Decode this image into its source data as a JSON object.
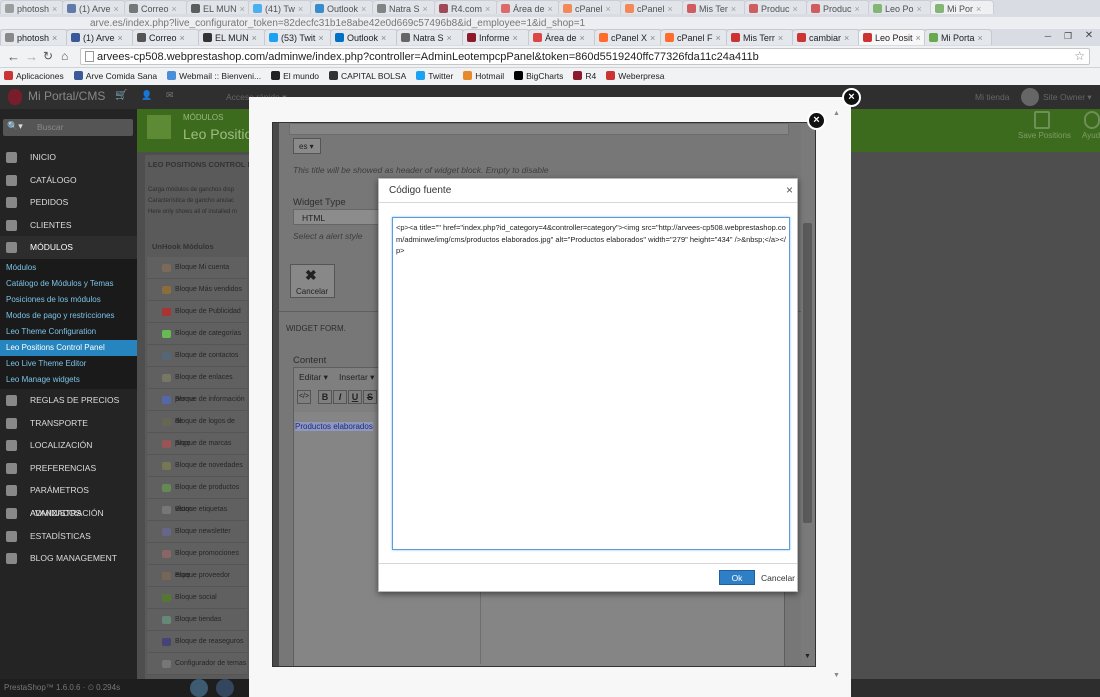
{
  "browser": {
    "tabs_row1": [
      "photosh",
      "(1) Arve",
      "Correo",
      "EL MUN",
      "(41) Tw",
      "Outlook",
      "Natra S",
      "R4.com",
      "Área de",
      "cPanel",
      "cPanel",
      "Mis Ter",
      "Produc",
      "Produc",
      "Leo Po",
      "Mi Por"
    ],
    "tabs_row2": [
      "photosh",
      "(1) Arve",
      "Correo",
      "EL MUN",
      "(53) Twit",
      "Outlook",
      "Natra S",
      "Informe",
      "Área de",
      "cPanel X",
      "cPanel F",
      "Mis Terr",
      "cambiar",
      "Leo Posit",
      "Mi Porta"
    ],
    "url_prev": "arve.es/index.php?live_configurator_token=82decfc31b1e8abe42e0d669c57496b8&id_employee=1&id_shop=1",
    "url": "arvees-cp508.webprestashop.com/adminwe/index.php?controller=AdminLeotempcpPanel&token=860d5519240ffc77326fda11c24a411b",
    "bookmarks": [
      "Aplicaciones",
      "Arve Comida Sana",
      "Webmail :: Bienveni...",
      "El mundo",
      "CAPITAL BOLSA",
      "Twitter",
      "Hotmail",
      "BigCharts",
      "R4",
      "Weberpresa"
    ]
  },
  "admin": {
    "brand": "Mi Portal/CMS",
    "quick_access": "Acceso rápido ▾",
    "my_shop": "Mi tienda",
    "user": "Site Owner ▾",
    "search_placeholder": "Buscar",
    "breadcrumb": "MÓDULOS",
    "page_title": "Leo Positions Control Panel",
    "toolbar_save": "Save Positions",
    "toolbar_help": "Ayuda",
    "footer": "PrestaShop™ 1.6.0.6 · ⏲ 0.294s",
    "menu": [
      "INICIO",
      "CATÁLOGO",
      "PEDIDOS",
      "CLIENTES",
      "MÓDULOS",
      "REGLAS DE PRECIOS",
      "TRANSPORTE",
      "LOCALIZACIÓN",
      "PREFERENCIAS",
      "PARÁMETROS AVANZADOS",
      "ADMINISTRACIÓN",
      "ESTADÍSTICAS",
      "BLOG MANAGEMENT"
    ],
    "submenu": [
      "Módulos",
      "Catálogo de Módulos y Temas",
      "Posiciones de los módulos",
      "Modos de pago y restricciones",
      "Leo Theme Configuration",
      "Leo Positions Control Panel",
      "Leo Live Theme Editor",
      "Leo Manage widgets"
    ]
  },
  "panel": {
    "title": "LEO POSITIONS CONTROL PANEL",
    "notes": [
      "Carga módulos de ganchos disp",
      "Característica de gancho anulac",
      "Here only shows all of installed m"
    ],
    "unhook_title": "UnHook Módulos",
    "modules": [
      "Bloque Mi cuenta",
      "Bloque Más vendidos",
      "Bloque de Publicidad",
      "Bloque de categorías",
      "Bloque de contactos",
      "Bloque de enlaces perma",
      "Bloque de información de",
      "Bloque de logos de pago",
      "Bloque de marcas",
      "Bloque de novedades",
      "Bloque de productos vistos",
      "Bloque etiquetas",
      "Bloque newsletter",
      "Bloque promociones espe",
      "Bloque proveedor",
      "Bloque social",
      "Bloque tiendas",
      "Bloque de reaseguros",
      "Configurador de temas"
    ]
  },
  "widget_modal": {
    "lang": "es ▾",
    "title_hint": "This title will be showed as header of widget block. Empty to disable",
    "widget_type_label": "Widget Type",
    "widget_type_value": "HTML",
    "alert_hint": "Select a alert style",
    "cancel_label": "Cancelar",
    "form_title": "WIDGET FORM.",
    "content_label": "Content",
    "editor_menu_edit": "Editar ▾",
    "editor_menu_insert": "Insertar ▾",
    "editor_content": "Productos elaborados"
  },
  "source_dialog": {
    "title": "Código fuente",
    "close": "×",
    "code": "<p><a title=\"\" href=\"index.php?id_category=4&controller=category\"><img src=\"http://arvees-cp508.webprestashop.com/adminwe/img/cms/productos elaborados.jpg\" alt=\"Productos elaborados\" width=\"279\" height=\"434\" />&nbsp;</a></p>",
    "ok": "Ok",
    "cancel": "Cancelar"
  }
}
